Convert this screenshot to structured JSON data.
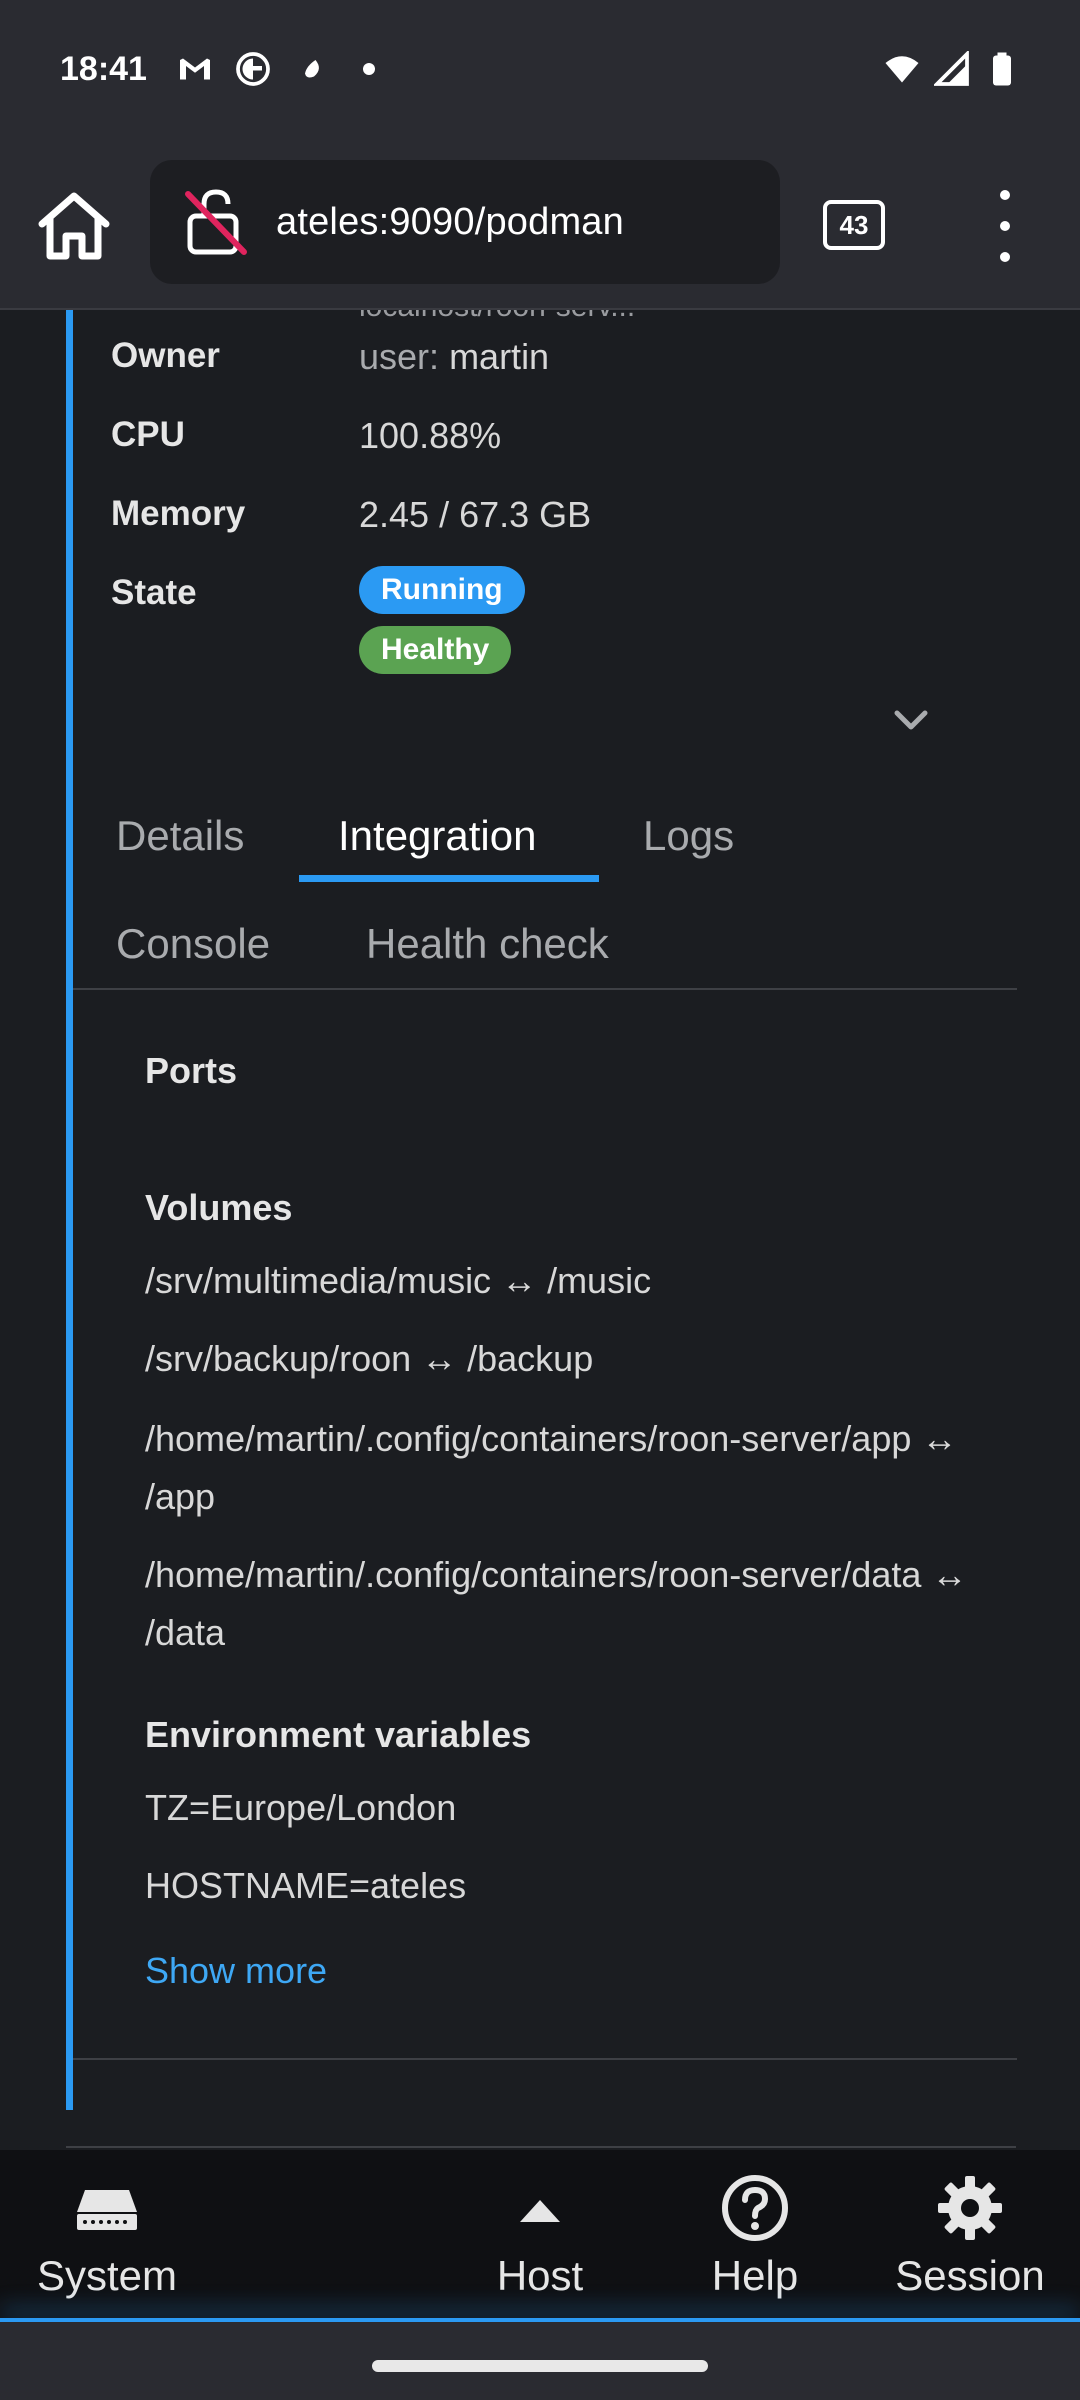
{
  "status_bar": {
    "time": "18:41"
  },
  "browser": {
    "url": "ateles:9090/podman",
    "tab_count": "43"
  },
  "container": {
    "image_truncated": "localhost/roon-serv...",
    "details": [
      {
        "label": "Owner",
        "value_prefix": "user:",
        "value": "martin"
      },
      {
        "label": "CPU",
        "value": "100.88%"
      },
      {
        "label": "Memory",
        "value": "2.45 / 67.3 GB"
      },
      {
        "label": "State"
      }
    ],
    "state_badges": [
      "Running",
      "Healthy"
    ],
    "colors": {
      "accent": "#2b9af3",
      "running": "#2b9af3",
      "healthy": "#5ba352",
      "link": "#3ea8f5"
    }
  },
  "tabs": [
    {
      "label": "Details",
      "active": false
    },
    {
      "label": "Integration",
      "active": true
    },
    {
      "label": "Logs",
      "active": false
    },
    {
      "label": "Console",
      "active": false
    },
    {
      "label": "Health check",
      "active": false
    }
  ],
  "integration": {
    "ports_title": "Ports",
    "volumes_title": "Volumes",
    "volumes": [
      "/srv/multimedia/music ↔ /music",
      "/srv/backup/roon ↔ /backup",
      "/home/martin/.config/containers/roon-server/app ↔ /app",
      "/home/martin/.config/containers/roon-server/data ↔ /data"
    ],
    "env_title": "Environment variables",
    "env": [
      "TZ=Europe/London",
      "HOSTNAME=ateles"
    ],
    "show_more": "Show more"
  },
  "bottom_nav": [
    {
      "label": "System",
      "icon": "server-icon"
    },
    {
      "label": "Host",
      "icon": "caret-up-icon"
    },
    {
      "label": "Help",
      "icon": "help-icon"
    },
    {
      "label": "Session",
      "icon": "gear-icon"
    }
  ]
}
